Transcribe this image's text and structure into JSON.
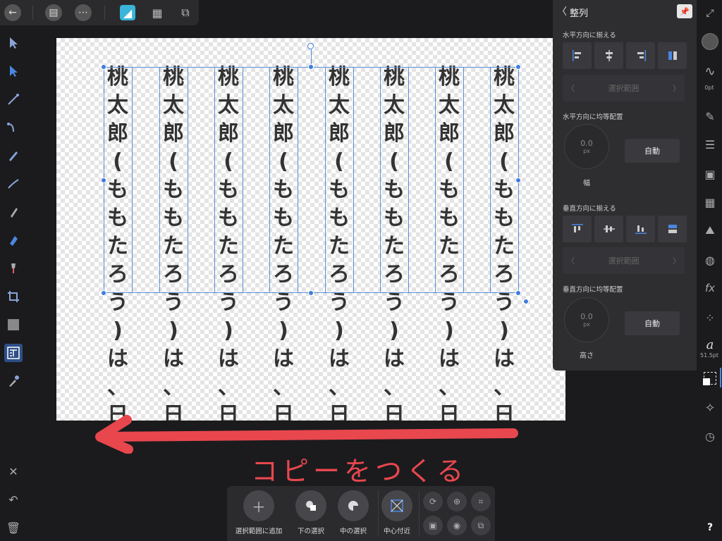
{
  "canvas": {
    "columns": [
      {
        "chars": [
          "桃",
          "太",
          "郎",
          "(",
          "も",
          "も",
          "た",
          "ろ",
          "う",
          ")",
          "は",
          "、",
          "日"
        ]
      },
      {
        "chars": [
          "桃",
          "太",
          "郎",
          "(",
          "も",
          "も",
          "た",
          "ろ",
          "う",
          ")",
          "は",
          "、",
          "日"
        ]
      },
      {
        "chars": [
          "桃",
          "太",
          "郎",
          "(",
          "も",
          "も",
          "た",
          "ろ",
          "う",
          ")",
          "は",
          "、",
          "日"
        ]
      },
      {
        "chars": [
          "桃",
          "太",
          "郎",
          "(",
          "も",
          "も",
          "た",
          "ろ",
          "う",
          ")",
          "は",
          "、",
          "日"
        ]
      },
      {
        "chars": [
          "桃",
          "太",
          "郎",
          "(",
          "も",
          "も",
          "た",
          "ろ",
          "う",
          ")",
          "は",
          "、",
          "日"
        ]
      },
      {
        "chars": [
          "桃",
          "太",
          "郎",
          "(",
          "も",
          "も",
          "た",
          "ろ",
          "う",
          ")",
          "は",
          "、",
          "日"
        ]
      },
      {
        "chars": [
          "桃",
          "太",
          "郎",
          "(",
          "も",
          "も",
          "た",
          "ろ",
          "う",
          ")",
          "は",
          "、",
          "日"
        ]
      },
      {
        "chars": [
          "桃",
          "太",
          "郎",
          "(",
          "も",
          "も",
          "た",
          "ろ",
          "う",
          ")",
          "は",
          "、",
          "日"
        ]
      }
    ]
  },
  "annotation": {
    "text": "コピーをつくる",
    "color": "#e8474e"
  },
  "panel": {
    "title": "整列",
    "h_align_label": "水平方向に揃える",
    "h_select": "選択範囲",
    "h_distribute_label": "水平方向に均等配置",
    "h_dial_value": "0.0",
    "h_dial_unit": "px",
    "h_dial_caption": "幅",
    "h_auto": "自動",
    "v_align_label": "垂直方向に揃える",
    "v_select": "選択範囲",
    "v_distribute_label": "垂直方向に均等配置",
    "v_dial_value": "0.0",
    "v_dial_unit": "px",
    "v_dial_caption": "高さ",
    "v_auto": "自動"
  },
  "righttools": {
    "stroke_width": "0pt",
    "font_size": "51.5pt",
    "help": "?"
  },
  "context": {
    "add_to_selection": "選択範囲に追加",
    "select_below": "下の選択",
    "select_inside": "中の選択",
    "near_center": "中心付近"
  },
  "colors": {
    "accent": "#3f7be0",
    "panel_bg": "#2e2e31",
    "app_bg": "#1b1b1d"
  }
}
